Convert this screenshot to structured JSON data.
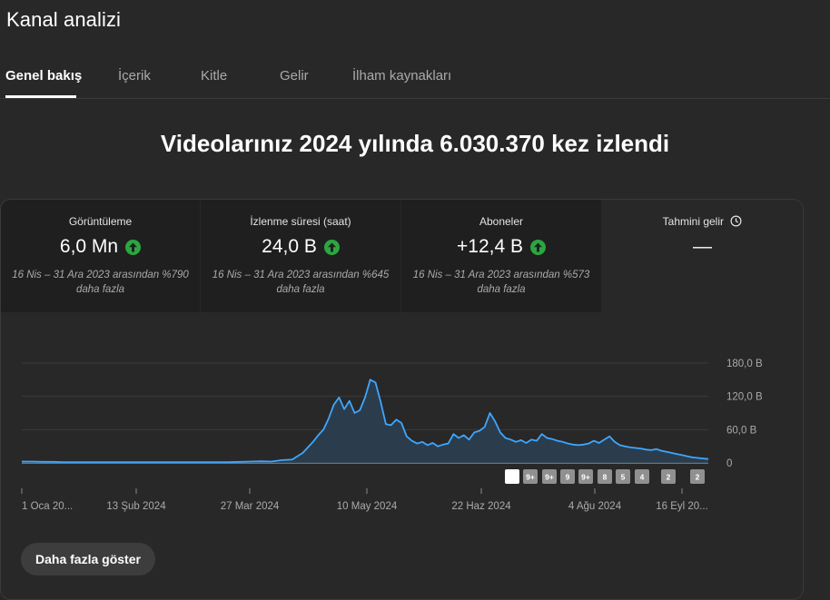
{
  "page": {
    "title": "Kanal analizi"
  },
  "tabs": [
    {
      "label": "Genel bakış",
      "active": true
    },
    {
      "label": "İçerik"
    },
    {
      "label": "Kitle"
    },
    {
      "label": "Gelir"
    },
    {
      "label": "İlham kaynakları"
    }
  ],
  "headline": "Videolarınız 2024 yılında 6.030.370 kez izlendi",
  "metrics": [
    {
      "label": "Görüntüleme",
      "value": "6,0 Mn",
      "trend": "up",
      "note": "16 Nis – 31 Ara 2023 arasından %790 daha fazla"
    },
    {
      "label": "İzlenme süresi (saat)",
      "value": "24,0 B",
      "trend": "up",
      "note": "16 Nis – 31 Ara 2023 arasından %645 daha fazla"
    },
    {
      "label": "Aboneler",
      "value": "+12,4 B",
      "trend": "up",
      "note": "16 Nis – 31 Ara 2023 arasından %573 daha fazla"
    },
    {
      "label": "Tahmini gelir",
      "value": "—",
      "icon": "clock-icon"
    }
  ],
  "chart_data": {
    "type": "area",
    "x_tick_labels": [
      "1 Oca 20...",
      "13 Şub 2024",
      "27 Mar 2024",
      "10 May 2024",
      "22 Haz 2024",
      "4 Ağu 2024",
      "16 Eyl 20..."
    ],
    "y_tick_labels": [
      "180,0 B",
      "120,0 B",
      "60,0 B",
      "0"
    ],
    "ylim": [
      0,
      180000
    ],
    "x_days": [
      0,
      4,
      8,
      12,
      16,
      20,
      24,
      28,
      32,
      36,
      40,
      44,
      48,
      52,
      56,
      60,
      64,
      68,
      72,
      76,
      80,
      84,
      88,
      92,
      96,
      100,
      104,
      108,
      112,
      114,
      116,
      118,
      120,
      122,
      124,
      126,
      128,
      130,
      132,
      134,
      136,
      138,
      140,
      142,
      144,
      146,
      148,
      150,
      152,
      154,
      156,
      158,
      160,
      162,
      164,
      166,
      168,
      170,
      172,
      174,
      176,
      178,
      180,
      182,
      184,
      186,
      188,
      190,
      192,
      194,
      196,
      198,
      200,
      202,
      204,
      206,
      208,
      210,
      212,
      214,
      216,
      218,
      220,
      222,
      224,
      226,
      228,
      230,
      232,
      234,
      236,
      238,
      240,
      242,
      244,
      246,
      248,
      250,
      252,
      254,
      256,
      258,
      260,
      262,
      264
    ],
    "values": [
      2500,
      2500,
      2000,
      2000,
      1500,
      1500,
      1500,
      1500,
      1500,
      1500,
      1500,
      1500,
      1500,
      1500,
      1500,
      1500,
      1500,
      1500,
      1500,
      1500,
      1500,
      2000,
      2500,
      3000,
      2500,
      5000,
      6000,
      18000,
      38000,
      50000,
      60000,
      80000,
      105000,
      118000,
      97000,
      112000,
      90000,
      95000,
      118000,
      150000,
      145000,
      110000,
      70000,
      68000,
      78000,
      72000,
      48000,
      40000,
      35000,
      38000,
      32000,
      36000,
      30000,
      33000,
      35000,
      52000,
      45000,
      50000,
      42000,
      55000,
      58000,
      65000,
      90000,
      75000,
      55000,
      45000,
      42000,
      38000,
      41000,
      36000,
      42000,
      40000,
      52000,
      45000,
      43000,
      40000,
      38000,
      35000,
      33000,
      32000,
      33000,
      35000,
      40000,
      36000,
      42000,
      48000,
      38000,
      32000,
      30000,
      28000,
      27000,
      26000,
      24000,
      23000,
      25000,
      22000,
      20000,
      18000,
      16000,
      14000,
      12000,
      10000,
      9000,
      8000,
      7000,
      6000
    ],
    "annotations": [
      "",
      "9+",
      "9+",
      "9",
      "9+",
      "8",
      "5",
      "4",
      "2",
      "2"
    ],
    "colors": {
      "line": "#3ea6ff",
      "fill": "#2c4152",
      "baseline": "#bdbdbd",
      "grid": "#3a3a3a",
      "marker": "#909090"
    }
  },
  "footer": {
    "more_label": "Daha fazla göster"
  }
}
